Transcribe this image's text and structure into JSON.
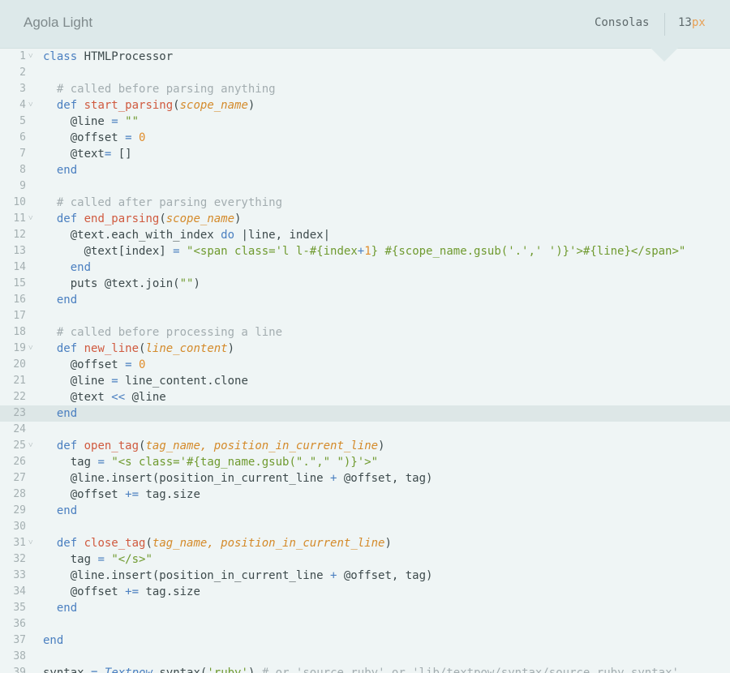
{
  "header": {
    "theme_name": "Agola Light",
    "font": "Consolas",
    "size_number": "13",
    "size_unit": "px"
  },
  "editor": {
    "highlighted_line": 23,
    "lines": [
      {
        "n": "1",
        "fold": true,
        "html": "<span class='k'>class</span> <span class='cls'>HTMLProcessor</span>"
      },
      {
        "n": "2",
        "fold": false,
        "html": ""
      },
      {
        "n": "3",
        "fold": false,
        "html": "  <span class='c'># called before parsing anything</span>"
      },
      {
        "n": "4",
        "fold": true,
        "html": "  <span class='k'>def</span> <span class='f'>start_parsing</span>(<span class='p'>scope_name</span>)"
      },
      {
        "n": "5",
        "fold": false,
        "html": "    @line <span class='o'>=</span> <span class='s'>\"\"</span>"
      },
      {
        "n": "6",
        "fold": false,
        "html": "    @offset <span class='o'>=</span> <span class='n'>0</span>"
      },
      {
        "n": "7",
        "fold": false,
        "html": "    @text<span class='o'>=</span> []"
      },
      {
        "n": "8",
        "fold": false,
        "html": "  <span class='k'>end</span>"
      },
      {
        "n": "9",
        "fold": false,
        "html": ""
      },
      {
        "n": "10",
        "fold": false,
        "html": "  <span class='c'># called after parsing everything</span>"
      },
      {
        "n": "11",
        "fold": true,
        "html": "  <span class='k'>def</span> <span class='f'>end_parsing</span>(<span class='p'>scope_name</span>)"
      },
      {
        "n": "12",
        "fold": false,
        "html": "    @text.each_with_index <span class='k'>do</span> |line, index|"
      },
      {
        "n": "13",
        "fold": false,
        "html": "      @text[index] <span class='o'>=</span> <span class='s'>\"&lt;span class='l l-#{index</span><span class='o'>+</span><span class='n'>1</span><span class='s'>} #{scope_name.gsub('.',' ')}'&gt;#{line}&lt;/span&gt;\"</span>"
      },
      {
        "n": "14",
        "fold": false,
        "html": "    <span class='k'>end</span>"
      },
      {
        "n": "15",
        "fold": false,
        "html": "    puts @text.join(<span class='s'>\"\"</span>)"
      },
      {
        "n": "16",
        "fold": false,
        "html": "  <span class='k'>end</span>"
      },
      {
        "n": "17",
        "fold": false,
        "html": ""
      },
      {
        "n": "18",
        "fold": false,
        "html": "  <span class='c'># called before processing a line</span>"
      },
      {
        "n": "19",
        "fold": true,
        "html": "  <span class='k'>def</span> <span class='f'>new_line</span>(<span class='p'>line_content</span>)"
      },
      {
        "n": "20",
        "fold": false,
        "html": "    @offset <span class='o'>=</span> <span class='n'>0</span>"
      },
      {
        "n": "21",
        "fold": false,
        "html": "    @line <span class='o'>=</span> line_content.clone"
      },
      {
        "n": "22",
        "fold": false,
        "html": "    @text <span class='o'>&lt;&lt;</span> @line"
      },
      {
        "n": "23",
        "fold": false,
        "html": "  <span class='k'>end</span>"
      },
      {
        "n": "24",
        "fold": false,
        "html": ""
      },
      {
        "n": "25",
        "fold": true,
        "html": "  <span class='k'>def</span> <span class='f'>open_tag</span>(<span class='p'>tag_name, position_in_current_line</span>)"
      },
      {
        "n": "26",
        "fold": false,
        "html": "    tag <span class='o'>=</span> <span class='s'>\"&lt;s class='#{tag_name.gsub(\".\",\" \")}'&gt;\"</span>"
      },
      {
        "n": "27",
        "fold": false,
        "html": "    @line.insert(position_in_current_line <span class='o'>+</span> @offset, tag)"
      },
      {
        "n": "28",
        "fold": false,
        "html": "    @offset <span class='o'>+=</span> tag.size"
      },
      {
        "n": "29",
        "fold": false,
        "html": "  <span class='k'>end</span>"
      },
      {
        "n": "30",
        "fold": false,
        "html": ""
      },
      {
        "n": "31",
        "fold": true,
        "html": "  <span class='k'>def</span> <span class='f'>close_tag</span>(<span class='p'>tag_name, position_in_current_line</span>)"
      },
      {
        "n": "32",
        "fold": false,
        "html": "    tag <span class='o'>=</span> <span class='s'>\"&lt;/s&gt;\"</span>"
      },
      {
        "n": "33",
        "fold": false,
        "html": "    @line.insert(position_in_current_line <span class='o'>+</span> @offset, tag)"
      },
      {
        "n": "34",
        "fold": false,
        "html": "    @offset <span class='o'>+=</span> tag.size"
      },
      {
        "n": "35",
        "fold": false,
        "html": "  <span class='k'>end</span>"
      },
      {
        "n": "36",
        "fold": false,
        "html": ""
      },
      {
        "n": "37",
        "fold": false,
        "html": "<span class='k'>end</span>"
      },
      {
        "n": "38",
        "fold": false,
        "html": ""
      },
      {
        "n": "39",
        "fold": false,
        "html": "syntax <span class='o'>=</span> <span class='ty'>Textpow</span>.syntax(<span class='s'>'ruby'</span>) <span class='c'># or 'source.ruby' or 'lib/textpow/syntax/source.ruby.syntax'</span>"
      }
    ]
  },
  "colors": {
    "background": "#eff5f5",
    "header": "#dde9ea",
    "keyword": "#4a7fc0",
    "function": "#d05a3f",
    "parameter": "#d48a2a",
    "string": "#6f9a2f",
    "number": "#e08d2c",
    "comment": "#a3adb0"
  }
}
